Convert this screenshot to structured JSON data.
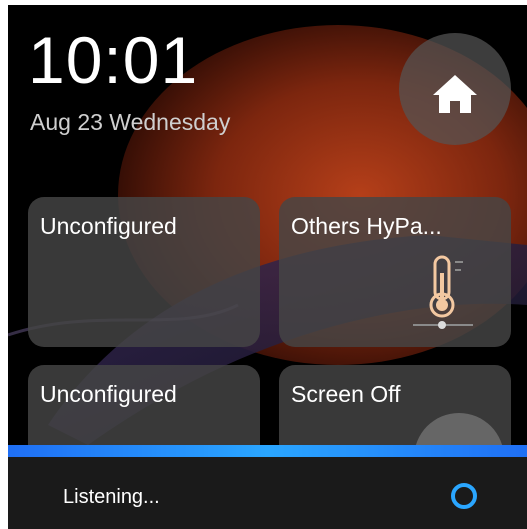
{
  "clock": {
    "time": "10:01",
    "date": "Aug 23  Wednesday"
  },
  "home_button": {
    "icon": "home-icon"
  },
  "tiles": [
    {
      "label": "Unconfigured"
    },
    {
      "label": "Others HyPa...",
      "icon": "thermometer-icon"
    },
    {
      "label": "Unconfigured"
    },
    {
      "label": "Screen Off"
    }
  ],
  "voice": {
    "status": "Listening...",
    "icon": "alexa-ring-icon",
    "accent": "#2aa6ff"
  },
  "colors": {
    "tile_bg": "#464646",
    "thermo_accent": "#f3c8a1"
  }
}
